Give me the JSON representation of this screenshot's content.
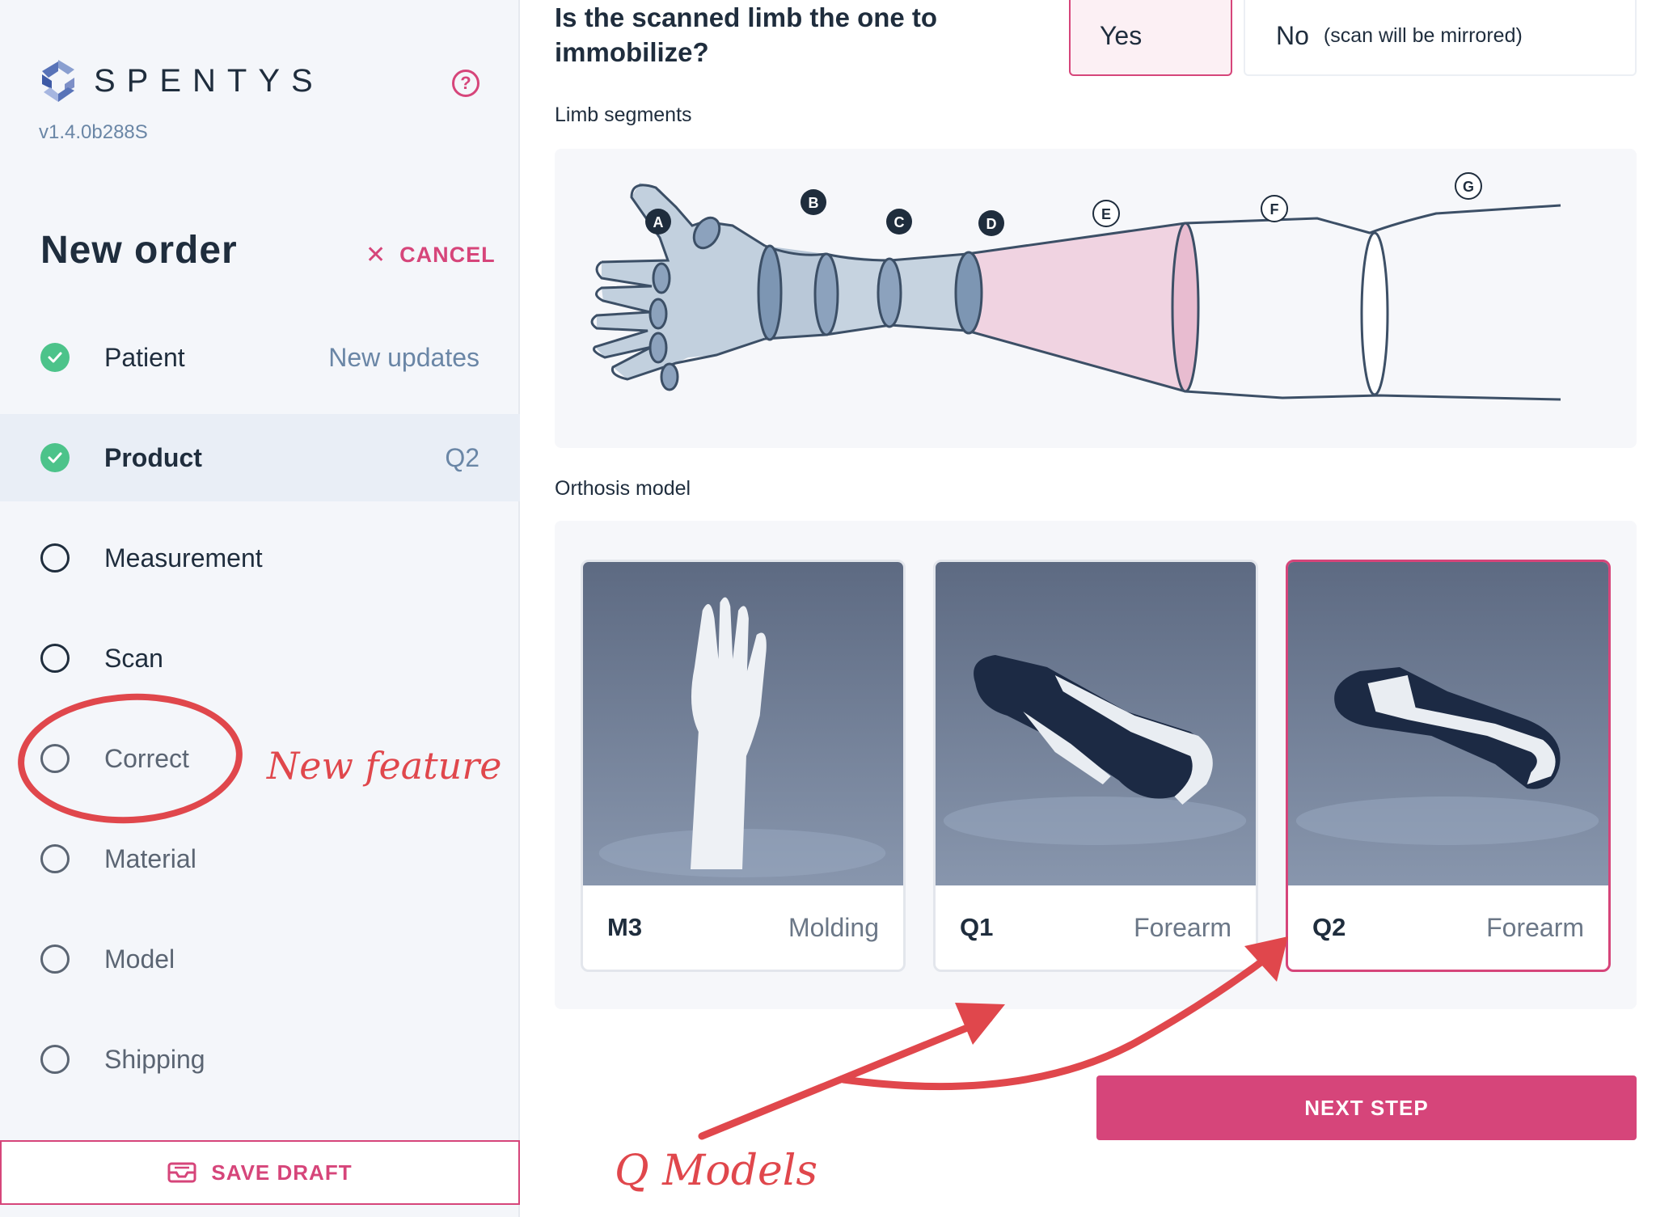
{
  "app": {
    "brand": "SPENTYS",
    "version": "v1.4.0b288S",
    "help_label": "?"
  },
  "order": {
    "title": "New order",
    "cancel_label": "CANCEL"
  },
  "steps": [
    {
      "label": "Patient",
      "status": "done",
      "right": "New updates"
    },
    {
      "label": "Product",
      "status": "done",
      "right": "Q2",
      "active": true
    },
    {
      "label": "Measurement",
      "status": "todo"
    },
    {
      "label": "Scan",
      "status": "todo"
    },
    {
      "label": "Correct",
      "status": "todo"
    },
    {
      "label": "Material",
      "status": "todo"
    },
    {
      "label": "Model",
      "status": "todo"
    },
    {
      "label": "Shipping",
      "status": "todo"
    }
  ],
  "save_draft_label": "SAVE DRAFT",
  "question": {
    "text": "Is the scanned limb the one to immobilize?",
    "yes_label": "Yes",
    "no_label": "No",
    "no_note": "(scan will be mirrored)",
    "selected": "Yes"
  },
  "limb_segments": {
    "label": "Limb segments",
    "markers": [
      "A",
      "B",
      "C",
      "D",
      "E",
      "F",
      "G"
    ]
  },
  "orthosis": {
    "label": "Orthosis model",
    "models": [
      {
        "code": "M3",
        "type": "Molding",
        "selected": false
      },
      {
        "code": "Q1",
        "type": "Forearm",
        "selected": false
      },
      {
        "code": "Q2",
        "type": "Forearm",
        "selected": true
      }
    ]
  },
  "next_step_label": "NEXT STEP",
  "annotations": {
    "new_feature": "New feature",
    "q_models": "Q Models"
  },
  "colors": {
    "accent": "#d6457a",
    "success": "#4cc38a",
    "annotation": "#e0474c",
    "sidebar_bg": "#f4f6fa",
    "segment_blue": "#b9c8d8",
    "segment_pink": "#f0d3e1"
  }
}
